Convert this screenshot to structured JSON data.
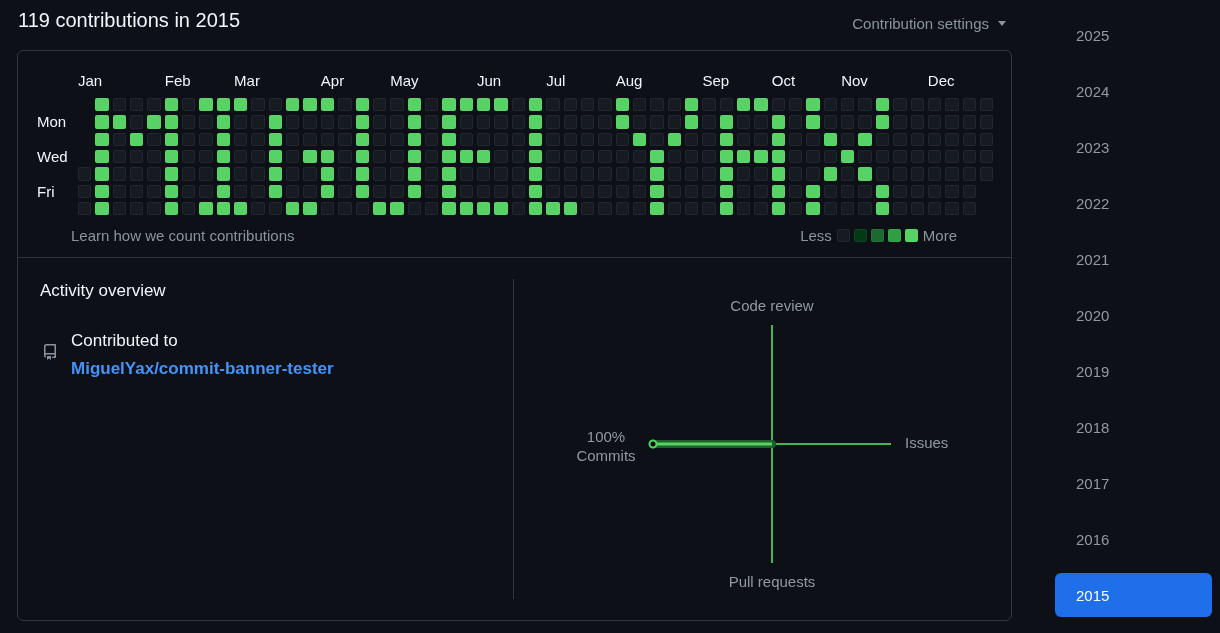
{
  "header": {
    "title": "119 contributions in 2015",
    "settings": "Contribution settings"
  },
  "calendar": {
    "weekdays": [
      "Mon",
      "Wed",
      "Fri"
    ],
    "weeks": [
      {
        "month": "Jan",
        "days": [
          {
            "color": "#161b22"
          },
          {
            "color": "#161b22"
          },
          {
            "color": "#161b22"
          }
        ]
      },
      {
        "days": [
          {
            "color": "#56d364"
          },
          {
            "color": "#56d364"
          },
          {
            "color": "#56d364"
          },
          {
            "color": "#56d364"
          },
          {
            "color": "#56d364"
          },
          {
            "color": "#56d364"
          },
          {
            "color": "#56d364"
          }
        ]
      },
      {
        "days": [
          {
            "color": "#161b22"
          },
          {
            "color": "#56d364"
          },
          {
            "color": "#161b22"
          },
          {
            "color": "#161b22"
          },
          {
            "color": "#161b22"
          },
          {
            "color": "#161b22"
          },
          {
            "color": "#161b22"
          }
        ]
      },
      {
        "days": [
          {
            "color": "#161b22"
          },
          {
            "color": "#161b22"
          },
          {
            "color": "#56d364"
          },
          {
            "color": "#161b22"
          },
          {
            "color": "#161b22"
          },
          {
            "color": "#161b22"
          },
          {
            "color": "#161b22"
          }
        ]
      },
      {
        "days": [
          {
            "color": "#161b22"
          },
          {
            "color": "#56d364"
          },
          {
            "color": "#161b22"
          },
          {
            "color": "#161b22"
          },
          {
            "color": "#161b22"
          },
          {
            "color": "#161b22"
          },
          {
            "color": "#161b22"
          }
        ]
      },
      {
        "month": "Feb",
        "days": [
          {
            "color": "#56d364"
          },
          {
            "color": "#56d364"
          },
          {
            "color": "#56d364"
          },
          {
            "color": "#56d364"
          },
          {
            "color": "#56d364"
          },
          {
            "color": "#56d364"
          },
          {
            "color": "#56d364"
          }
        ]
      },
      {
        "days": [
          {
            "color": "#161b22"
          },
          {
            "color": "#161b22"
          },
          {
            "color": "#161b22"
          },
          {
            "color": "#161b22"
          },
          {
            "color": "#161b22"
          },
          {
            "color": "#161b22"
          },
          {
            "color": "#161b22"
          }
        ]
      },
      {
        "days": [
          {
            "color": "#56d364"
          },
          {
            "color": "#161b22"
          },
          {
            "color": "#161b22"
          },
          {
            "color": "#161b22"
          },
          {
            "color": "#161b22"
          },
          {
            "color": "#161b22"
          },
          {
            "color": "#56d364"
          }
        ]
      },
      {
        "days": [
          {
            "color": "#56d364"
          },
          {
            "color": "#56d364"
          },
          {
            "color": "#56d364"
          },
          {
            "color": "#56d364"
          },
          {
            "color": "#56d364"
          },
          {
            "color": "#56d364"
          },
          {
            "color": "#56d364"
          }
        ]
      },
      {
        "month": "Mar",
        "days": [
          {
            "color": "#56d364"
          },
          {
            "color": "#161b22"
          },
          {
            "color": "#161b22"
          },
          {
            "color": "#161b22"
          },
          {
            "color": "#161b22"
          },
          {
            "color": "#161b22"
          },
          {
            "color": "#56d364"
          }
        ]
      },
      {
        "days": [
          {
            "color": "#161b22"
          },
          {
            "color": "#161b22"
          },
          {
            "color": "#161b22"
          },
          {
            "color": "#161b22"
          },
          {
            "color": "#161b22"
          },
          {
            "color": "#161b22"
          },
          {
            "color": "#161b22"
          }
        ]
      },
      {
        "days": [
          {
            "color": "#161b22"
          },
          {
            "color": "#56d364"
          },
          {
            "color": "#56d364"
          },
          {
            "color": "#56d364"
          },
          {
            "color": "#56d364"
          },
          {
            "color": "#56d364"
          },
          {
            "color": "#161b22"
          }
        ]
      },
      {
        "days": [
          {
            "color": "#56d364"
          },
          {
            "color": "#161b22"
          },
          {
            "color": "#161b22"
          },
          {
            "color": "#161b22"
          },
          {
            "color": "#161b22"
          },
          {
            "color": "#161b22"
          },
          {
            "color": "#56d364"
          }
        ]
      },
      {
        "days": [
          {
            "color": "#56d364"
          },
          {
            "color": "#161b22"
          },
          {
            "color": "#161b22"
          },
          {
            "color": "#56d364"
          },
          {
            "color": "#161b22"
          },
          {
            "color": "#161b22"
          },
          {
            "color": "#56d364"
          }
        ]
      },
      {
        "month": "Apr",
        "days": [
          {
            "color": "#56d364"
          },
          {
            "color": "#161b22"
          },
          {
            "color": "#161b22"
          },
          {
            "color": "#56d364"
          },
          {
            "color": "#56d364"
          },
          {
            "color": "#56d364"
          },
          {
            "color": "#161b22"
          }
        ]
      },
      {
        "days": [
          {
            "color": "#161b22"
          },
          {
            "color": "#161b22"
          },
          {
            "color": "#161b22"
          },
          {
            "color": "#161b22"
          },
          {
            "color": "#161b22"
          },
          {
            "color": "#161b22"
          },
          {
            "color": "#161b22"
          }
        ]
      },
      {
        "days": [
          {
            "color": "#56d364"
          },
          {
            "color": "#56d364"
          },
          {
            "color": "#56d364"
          },
          {
            "color": "#56d364"
          },
          {
            "color": "#56d364"
          },
          {
            "color": "#56d364"
          },
          {
            "color": "#161b22"
          }
        ]
      },
      {
        "days": [
          {
            "color": "#161b22"
          },
          {
            "color": "#161b22"
          },
          {
            "color": "#161b22"
          },
          {
            "color": "#161b22"
          },
          {
            "color": "#161b22"
          },
          {
            "color": "#161b22"
          },
          {
            "color": "#56d364"
          }
        ]
      },
      {
        "month": "May",
        "days": [
          {
            "color": "#161b22"
          },
          {
            "color": "#161b22"
          },
          {
            "color": "#161b22"
          },
          {
            "color": "#161b22"
          },
          {
            "color": "#161b22"
          },
          {
            "color": "#161b22"
          },
          {
            "color": "#56d364"
          }
        ]
      },
      {
        "days": [
          {
            "color": "#56d364"
          },
          {
            "color": "#56d364"
          },
          {
            "color": "#56d364"
          },
          {
            "color": "#56d364"
          },
          {
            "color": "#56d364"
          },
          {
            "color": "#56d364"
          },
          {
            "color": "#161b22"
          }
        ]
      },
      {
        "days": [
          {
            "color": "#161b22"
          },
          {
            "color": "#161b22"
          },
          {
            "color": "#161b22"
          },
          {
            "color": "#161b22"
          },
          {
            "color": "#161b22"
          },
          {
            "color": "#161b22"
          },
          {
            "color": "#161b22"
          }
        ]
      },
      {
        "days": [
          {
            "color": "#56d364"
          },
          {
            "color": "#56d364"
          },
          {
            "color": "#56d364"
          },
          {
            "color": "#56d364"
          },
          {
            "color": "#56d364"
          },
          {
            "color": "#56d364"
          },
          {
            "color": "#56d364"
          }
        ]
      },
      {
        "days": [
          {
            "color": "#56d364"
          },
          {
            "color": "#161b22"
          },
          {
            "color": "#161b22"
          },
          {
            "color": "#56d364"
          },
          {
            "color": "#161b22"
          },
          {
            "color": "#161b22"
          },
          {
            "color": "#56d364"
          }
        ]
      },
      {
        "month": "Jun",
        "days": [
          {
            "color": "#56d364"
          },
          {
            "color": "#161b22"
          },
          {
            "color": "#161b22"
          },
          {
            "color": "#56d364"
          },
          {
            "color": "#161b22"
          },
          {
            "color": "#161b22"
          },
          {
            "color": "#56d364"
          }
        ]
      },
      {
        "days": [
          {
            "color": "#56d364"
          },
          {
            "color": "#161b22"
          },
          {
            "color": "#161b22"
          },
          {
            "color": "#161b22"
          },
          {
            "color": "#161b22"
          },
          {
            "color": "#161b22"
          },
          {
            "color": "#56d364"
          }
        ]
      },
      {
        "days": [
          {
            "color": "#161b22"
          },
          {
            "color": "#161b22"
          },
          {
            "color": "#161b22"
          },
          {
            "color": "#161b22"
          },
          {
            "color": "#161b22"
          },
          {
            "color": "#161b22"
          },
          {
            "color": "#161b22"
          }
        ]
      },
      {
        "days": [
          {
            "color": "#56d364"
          },
          {
            "color": "#56d364"
          },
          {
            "color": "#56d364"
          },
          {
            "color": "#56d364"
          },
          {
            "color": "#56d364"
          },
          {
            "color": "#56d364"
          },
          {
            "color": "#56d364"
          }
        ]
      },
      {
        "month": "Jul",
        "days": [
          {
            "color": "#161b22"
          },
          {
            "color": "#161b22"
          },
          {
            "color": "#161b22"
          },
          {
            "color": "#161b22"
          },
          {
            "color": "#161b22"
          },
          {
            "color": "#161b22"
          },
          {
            "color": "#56d364"
          }
        ]
      },
      {
        "days": [
          {
            "color": "#161b22"
          },
          {
            "color": "#161b22"
          },
          {
            "color": "#161b22"
          },
          {
            "color": "#161b22"
          },
          {
            "color": "#161b22"
          },
          {
            "color": "#161b22"
          },
          {
            "color": "#56d364"
          }
        ]
      },
      {
        "days": [
          {
            "color": "#161b22"
          },
          {
            "color": "#161b22"
          },
          {
            "color": "#161b22"
          },
          {
            "color": "#161b22"
          },
          {
            "color": "#161b22"
          },
          {
            "color": "#161b22"
          },
          {
            "color": "#161b22"
          }
        ]
      },
      {
        "days": [
          {
            "color": "#161b22"
          },
          {
            "color": "#161b22"
          },
          {
            "color": "#161b22"
          },
          {
            "color": "#161b22"
          },
          {
            "color": "#161b22"
          },
          {
            "color": "#161b22"
          },
          {
            "color": "#161b22"
          }
        ]
      },
      {
        "month": "Aug",
        "days": [
          {
            "color": "#56d364"
          },
          {
            "color": "#56d364"
          },
          {
            "color": "#161b22"
          },
          {
            "color": "#161b22"
          },
          {
            "color": "#161b22"
          },
          {
            "color": "#161b22"
          },
          {
            "color": "#161b22"
          }
        ]
      },
      {
        "days": [
          {
            "color": "#161b22"
          },
          {
            "color": "#161b22"
          },
          {
            "color": "#56d364"
          },
          {
            "color": "#161b22"
          },
          {
            "color": "#161b22"
          },
          {
            "color": "#161b22"
          },
          {
            "color": "#161b22"
          }
        ]
      },
      {
        "days": [
          {
            "color": "#161b22"
          },
          {
            "color": "#161b22"
          },
          {
            "color": "#161b22"
          },
          {
            "color": "#56d364"
          },
          {
            "color": "#56d364"
          },
          {
            "color": "#56d364"
          },
          {
            "color": "#56d364"
          }
        ]
      },
      {
        "days": [
          {
            "color": "#161b22"
          },
          {
            "color": "#161b22"
          },
          {
            "color": "#56d364"
          },
          {
            "color": "#161b22"
          },
          {
            "color": "#161b22"
          },
          {
            "color": "#161b22"
          },
          {
            "color": "#161b22"
          }
        ]
      },
      {
        "days": [
          {
            "color": "#56d364"
          },
          {
            "color": "#56d364"
          },
          {
            "color": "#161b22"
          },
          {
            "color": "#161b22"
          },
          {
            "color": "#161b22"
          },
          {
            "color": "#161b22"
          },
          {
            "color": "#161b22"
          }
        ]
      },
      {
        "month": "Sep",
        "days": [
          {
            "color": "#161b22"
          },
          {
            "color": "#161b22"
          },
          {
            "color": "#161b22"
          },
          {
            "color": "#161b22"
          },
          {
            "color": "#161b22"
          },
          {
            "color": "#161b22"
          },
          {
            "color": "#161b22"
          }
        ]
      },
      {
        "days": [
          {
            "color": "#161b22"
          },
          {
            "color": "#56d364"
          },
          {
            "color": "#56d364"
          },
          {
            "color": "#56d364"
          },
          {
            "color": "#56d364"
          },
          {
            "color": "#56d364"
          },
          {
            "color": "#56d364"
          }
        ]
      },
      {
        "days": [
          {
            "color": "#56d364"
          },
          {
            "color": "#161b22"
          },
          {
            "color": "#161b22"
          },
          {
            "color": "#56d364"
          },
          {
            "color": "#161b22"
          },
          {
            "color": "#161b22"
          },
          {
            "color": "#161b22"
          }
        ]
      },
      {
        "days": [
          {
            "color": "#56d364"
          },
          {
            "color": "#161b22"
          },
          {
            "color": "#161b22"
          },
          {
            "color": "#56d364"
          },
          {
            "color": "#161b22"
          },
          {
            "color": "#161b22"
          },
          {
            "color": "#161b22"
          }
        ]
      },
      {
        "month": "Oct",
        "days": [
          {
            "color": "#161b22"
          },
          {
            "color": "#56d364"
          },
          {
            "color": "#56d364"
          },
          {
            "color": "#56d364"
          },
          {
            "color": "#56d364"
          },
          {
            "color": "#56d364"
          },
          {
            "color": "#56d364"
          }
        ]
      },
      {
        "days": [
          {
            "color": "#161b22"
          },
          {
            "color": "#161b22"
          },
          {
            "color": "#161b22"
          },
          {
            "color": "#161b22"
          },
          {
            "color": "#161b22"
          },
          {
            "color": "#161b22"
          },
          {
            "color": "#161b22"
          }
        ]
      },
      {
        "days": [
          {
            "color": "#56d364"
          },
          {
            "color": "#56d364"
          },
          {
            "color": "#161b22"
          },
          {
            "color": "#161b22"
          },
          {
            "color": "#161b22"
          },
          {
            "color": "#56d364"
          },
          {
            "color": "#56d364"
          }
        ]
      },
      {
        "days": [
          {
            "color": "#161b22"
          },
          {
            "color": "#161b22"
          },
          {
            "color": "#56d364"
          },
          {
            "color": "#161b22"
          },
          {
            "color": "#56d364"
          },
          {
            "color": "#161b22"
          },
          {
            "color": "#161b22"
          }
        ]
      },
      {
        "month": "Nov",
        "days": [
          {
            "color": "#161b22"
          },
          {
            "color": "#161b22"
          },
          {
            "color": "#161b22"
          },
          {
            "color": "#56d364"
          },
          {
            "color": "#161b22"
          },
          {
            "color": "#161b22"
          },
          {
            "color": "#161b22"
          }
        ]
      },
      {
        "days": [
          {
            "color": "#161b22"
          },
          {
            "color": "#161b22"
          },
          {
            "color": "#56d364"
          },
          {
            "color": "#161b22"
          },
          {
            "color": "#56d364"
          },
          {
            "color": "#161b22"
          },
          {
            "color": "#161b22"
          }
        ]
      },
      {
        "days": [
          {
            "color": "#56d364"
          },
          {
            "color": "#56d364"
          },
          {
            "color": "#161b22"
          },
          {
            "color": "#161b22"
          },
          {
            "color": "#161b22"
          },
          {
            "color": "#56d364"
          },
          {
            "color": "#56d364"
          }
        ]
      },
      {
        "days": [
          {
            "color": "#161b22"
          },
          {
            "color": "#161b22"
          },
          {
            "color": "#161b22"
          },
          {
            "color": "#161b22"
          },
          {
            "color": "#161b22"
          },
          {
            "color": "#161b22"
          },
          {
            "color": "#161b22"
          }
        ]
      },
      {
        "days": [
          {
            "color": "#161b22"
          },
          {
            "color": "#161b22"
          },
          {
            "color": "#161b22"
          },
          {
            "color": "#161b22"
          },
          {
            "color": "#161b22"
          },
          {
            "color": "#161b22"
          },
          {
            "color": "#161b22"
          }
        ]
      },
      {
        "month": "Dec",
        "days": [
          {
            "color": "#161b22"
          },
          {
            "color": "#161b22"
          },
          {
            "color": "#161b22"
          },
          {
            "color": "#161b22"
          },
          {
            "color": "#161b22"
          },
          {
            "color": "#161b22"
          },
          {
            "color": "#161b22"
          }
        ]
      },
      {
        "days": [
          {
            "color": "#161b22"
          },
          {
            "color": "#161b22"
          },
          {
            "color": "#161b22"
          },
          {
            "color": "#161b22"
          },
          {
            "color": "#161b22"
          },
          {
            "color": "#161b22"
          },
          {
            "color": "#161b22"
          }
        ]
      },
      {
        "days": [
          {
            "color": "#161b22"
          },
          {
            "color": "#161b22"
          },
          {
            "color": "#161b22"
          },
          {
            "color": "#161b22"
          },
          {
            "color": "#161b22"
          },
          {
            "color": "#161b22"
          },
          {
            "color": "#161b22"
          }
        ]
      },
      {
        "days": [
          {
            "color": "#161b22"
          },
          {
            "color": "#161b22"
          },
          {
            "color": "#161b22"
          },
          {
            "color": "#161b22"
          },
          {
            "color": "#161b22"
          }
        ]
      }
    ],
    "footer_link": "Learn how we count contributions",
    "legend": {
      "less": "Less",
      "more": "More",
      "levels": [
        {
          "color": "#161b22"
        },
        {
          "color": "#033a16"
        },
        {
          "color": "#196c2e"
        },
        {
          "color": "#2ea043"
        },
        {
          "color": "#56d364"
        }
      ]
    }
  },
  "activity": {
    "title": "Activity overview",
    "contributed_label": "Contributed to",
    "repo": "MiguelYax/commit-banner-tester",
    "axes": [
      {
        "kind": "top",
        "label": "Code review"
      },
      {
        "kind": "right",
        "label": "Issues"
      },
      {
        "kind": "bottom",
        "label": "Pull requests"
      },
      {
        "kind": "left",
        "label": "Commits",
        "percent": "100%",
        "level": 1
      }
    ]
  },
  "years": [
    {
      "label": "2025",
      "selected": false
    },
    {
      "label": "2024",
      "selected": false
    },
    {
      "label": "2023",
      "selected": false
    },
    {
      "label": "2022",
      "selected": false
    },
    {
      "label": "2021",
      "selected": false
    },
    {
      "label": "2020",
      "selected": false
    },
    {
      "label": "2019",
      "selected": false
    },
    {
      "label": "2018",
      "selected": false
    },
    {
      "label": "2017",
      "selected": false
    },
    {
      "label": "2016",
      "selected": false
    },
    {
      "label": "2015",
      "selected": true
    }
  ]
}
